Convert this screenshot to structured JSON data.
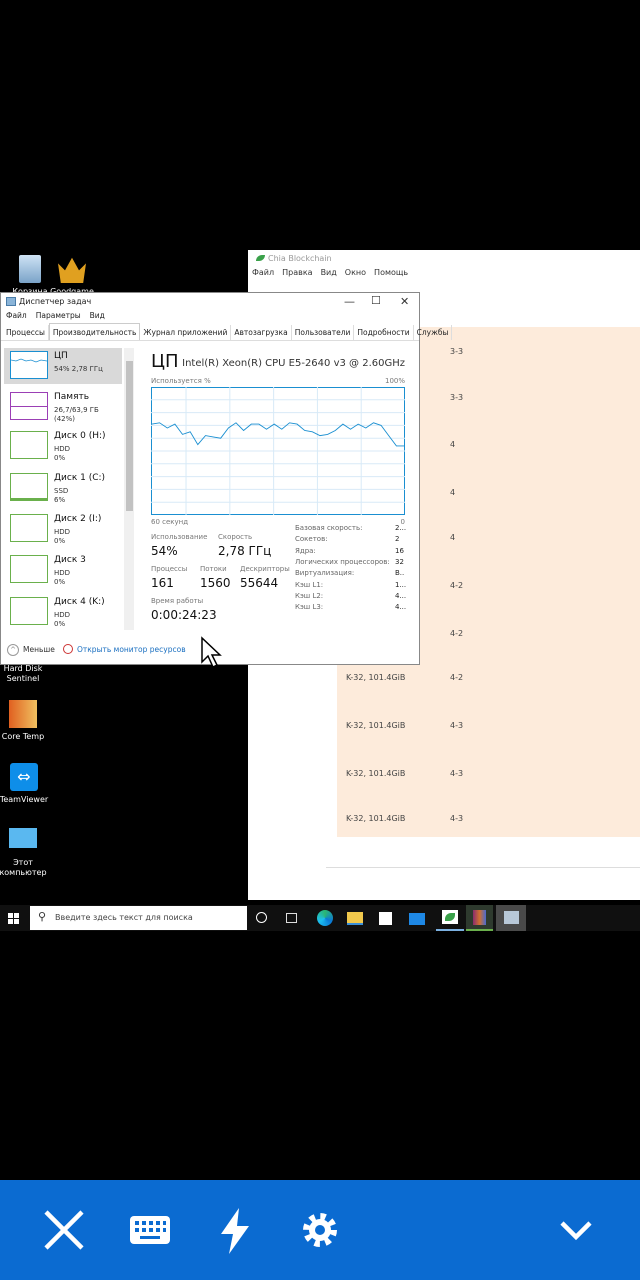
{
  "desktop": {
    "icons": [
      "Корзина",
      "Goodgame",
      "Hard Disk Sentinel",
      "Core Temp",
      "TeamViewer",
      "Этот компьютер"
    ]
  },
  "chia": {
    "title": "Chia Blockchain",
    "menu": [
      "Файл",
      "Правка",
      "Вид",
      "Окно",
      "Помощь"
    ],
    "rows": [
      {
        "size": "",
        "label": "3-3"
      },
      {
        "size": "",
        "label": "3-3"
      },
      {
        "size": "",
        "label": "4"
      },
      {
        "size": "",
        "label": "4"
      },
      {
        "size": "",
        "label": "4"
      },
      {
        "size": "",
        "label": "4-2"
      },
      {
        "size": "",
        "label": "4-2"
      },
      {
        "size": "K-32, 101.4GiB",
        "label": "4-2"
      },
      {
        "size": "K-32, 101.4GiB",
        "label": "4-3"
      },
      {
        "size": "K-32, 101.4GiB",
        "label": "4-3"
      },
      {
        "size": "K-32, 101.4GiB",
        "label": "4-3"
      }
    ]
  },
  "taskmgr": {
    "title": "Диспетчер задач",
    "menu": [
      "Файл",
      "Параметры",
      "Вид"
    ],
    "tabs": [
      "Процессы",
      "Производительность",
      "Журнал приложений",
      "Автозагрузка",
      "Пользователи",
      "Подробности",
      "Службы"
    ],
    "active_tab": "Производительность",
    "sidebar": [
      {
        "name": "ЦП",
        "l1": "54% 2,78 ГГц",
        "l2": "",
        "color": "#1a8fd1"
      },
      {
        "name": "Память",
        "l1": "26,7/63,9 ГБ (42%)",
        "l2": "",
        "color": "#9b3fb5"
      },
      {
        "name": "Диск 0 (H:)",
        "l1": "HDD",
        "l2": "0%",
        "color": "#6ab04c"
      },
      {
        "name": "Диск 1 (C:)",
        "l1": "SSD",
        "l2": "6%",
        "color": "#6ab04c"
      },
      {
        "name": "Диск 2 (I:)",
        "l1": "HDD",
        "l2": "0%",
        "color": "#6ab04c"
      },
      {
        "name": "Диск 3",
        "l1": "HDD",
        "l2": "0%",
        "color": "#6ab04c"
      },
      {
        "name": "Диск 4 (K:)",
        "l1": "HDD",
        "l2": "0%",
        "color": "#6ab04c"
      }
    ],
    "cpu": {
      "title": "ЦП",
      "model": "Intel(R) Xeon(R) CPU E5-2640 v3 @ 2.60GHz",
      "graph_label": "Используется %",
      "graph_max": "100%",
      "graph_time": "60 секунд",
      "graph_min": "0",
      "history": [
        71,
        72,
        68,
        71,
        63,
        65,
        55,
        62,
        61,
        60,
        68,
        72,
        66,
        71,
        71,
        67,
        71,
        67,
        72,
        71,
        66,
        65,
        62,
        63,
        66,
        71,
        67,
        71,
        68,
        72,
        70,
        62,
        54,
        54
      ],
      "usage_label": "Использование",
      "usage": "54%",
      "speed_label": "Скорость",
      "speed": "2,78 ГГц",
      "proc_label": "Процессы",
      "proc": "161",
      "threads_label": "Потоки",
      "threads": "1560",
      "handles_label": "Дескрипторы",
      "handles": "55644",
      "uptime_label": "Время работы",
      "uptime": "0:00:24:23",
      "specs": [
        {
          "k": "Базовая скорость:",
          "v": "2..."
        },
        {
          "k": "Сокетов:",
          "v": "2"
        },
        {
          "k": "Ядра:",
          "v": "16"
        },
        {
          "k": "Логических процессоров:",
          "v": "32"
        },
        {
          "k": "Виртуализация:",
          "v": "В.."
        },
        {
          "k": "Кэш L1:",
          "v": "1..."
        },
        {
          "k": "Кэш L2:",
          "v": "4..."
        },
        {
          "k": "Кэш L3:",
          "v": "4..."
        }
      ]
    },
    "footer": {
      "less": "Меньше",
      "monitor": "Открыть монитор ресурсов"
    }
  },
  "taskbar": {
    "search_placeholder": "Введите здесь текст для поиска"
  },
  "colors": {
    "remote_bar": "#0b6bd1",
    "chia_row": "#fdebdb",
    "cpu_line": "#1a8fd1"
  }
}
